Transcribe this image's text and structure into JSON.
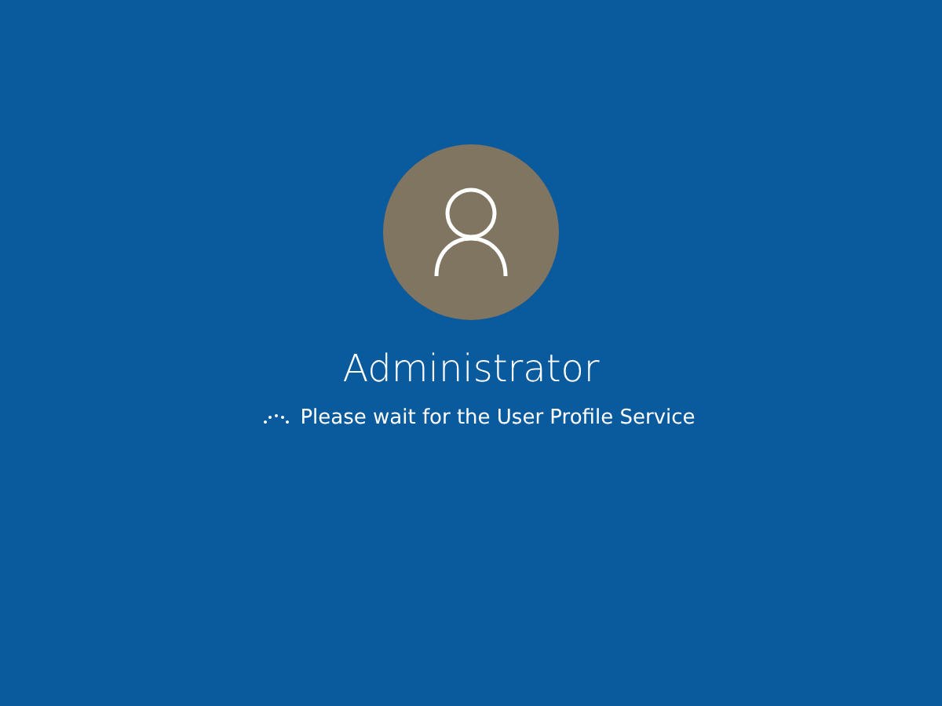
{
  "user": {
    "name": "Administrator"
  },
  "status": {
    "message": "Please wait for the User Profile Service"
  }
}
